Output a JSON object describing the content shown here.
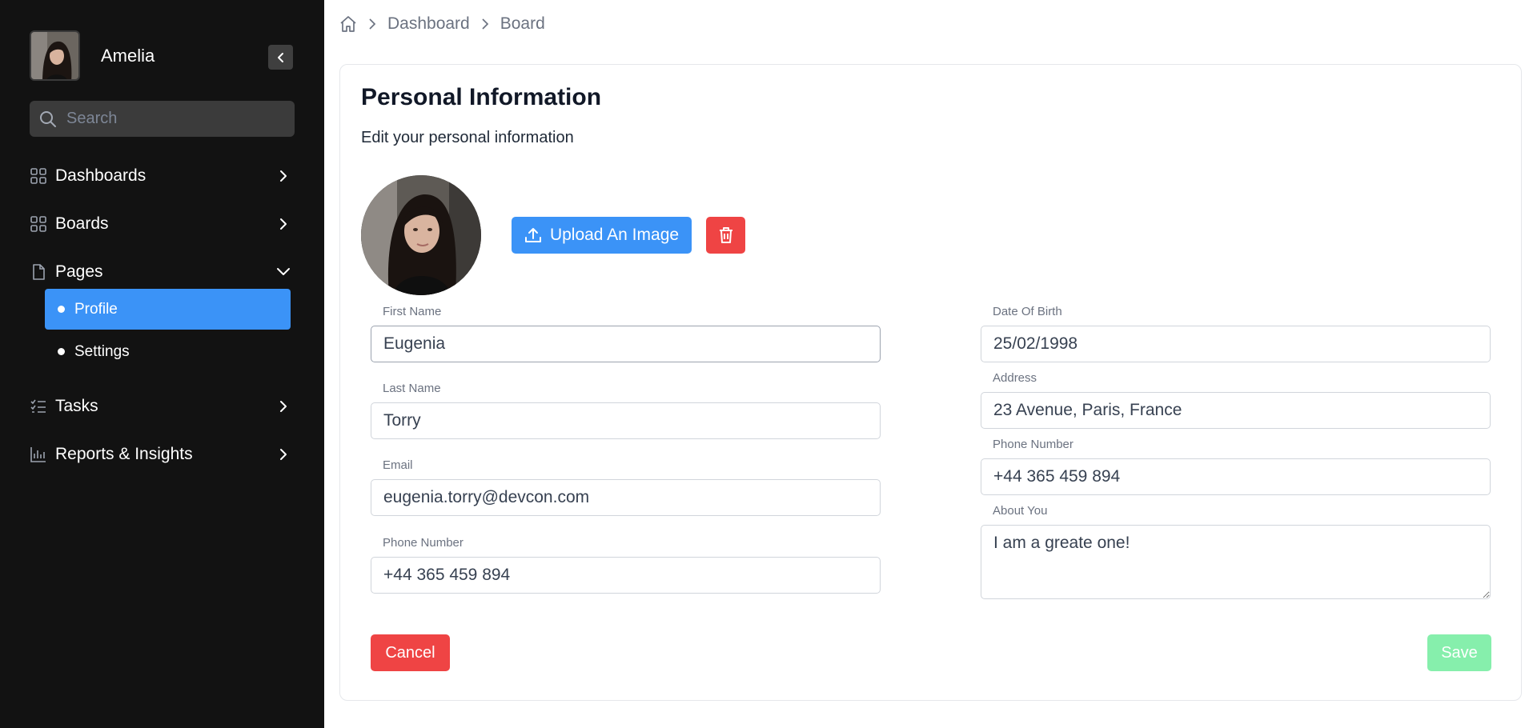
{
  "sidebar": {
    "user_name": "Amelia",
    "search_placeholder": "Search",
    "items": [
      {
        "label": "Dashboards",
        "icon": "grid-icon"
      },
      {
        "label": "Boards",
        "icon": "grid-icon"
      },
      {
        "label": "Pages",
        "icon": "file-icon",
        "expanded": true
      },
      {
        "label": "Tasks",
        "icon": "list-check-icon"
      },
      {
        "label": "Reports & Insights",
        "icon": "bar-chart-icon"
      }
    ],
    "sub_items": [
      {
        "label": "Profile",
        "active": true
      },
      {
        "label": "Settings",
        "active": false
      }
    ]
  },
  "breadcrumb": {
    "items": [
      "Dashboard",
      "Board"
    ]
  },
  "card": {
    "title": "Personal Information",
    "subtitle": "Edit your personal information",
    "upload_label": "Upload An Image",
    "cancel_label": "Cancel",
    "save_label": "Save"
  },
  "form": {
    "first_name": {
      "label": "First Name",
      "value": "Eugenia"
    },
    "last_name": {
      "label": "Last Name",
      "value": "Torry"
    },
    "email": {
      "label": "Email",
      "value": "eugenia.torry@devcon.com"
    },
    "phone_left": {
      "label": "Phone Number",
      "value": "+44 365 459 894"
    },
    "dob": {
      "label": "Date Of Birth",
      "value": "25/02/1998"
    },
    "address": {
      "label": "Address",
      "value": "23 Avenue, Paris, France"
    },
    "phone_right": {
      "label": "Phone Number",
      "value": "+44 365 459 894"
    },
    "about": {
      "label": "About You",
      "value": "I am a greate one!"
    }
  },
  "colors": {
    "sidebar_bg": "#121212",
    "accent": "#3b93f7",
    "danger": "#ef4444",
    "save_disabled": "#86efac"
  }
}
